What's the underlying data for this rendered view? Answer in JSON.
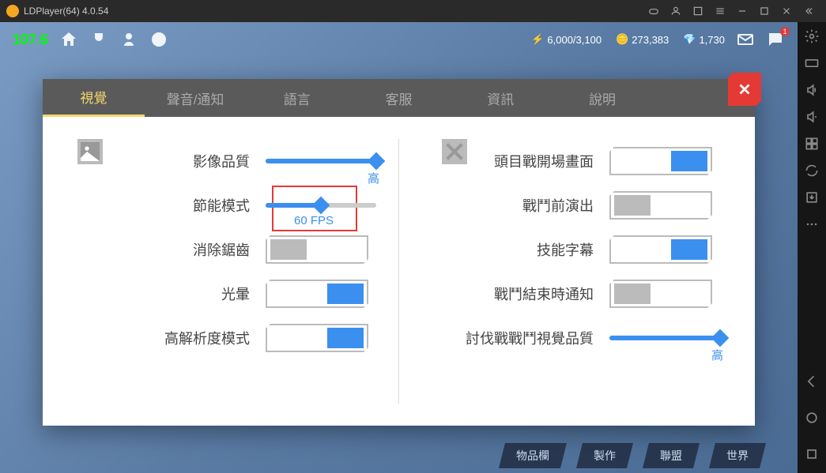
{
  "titlebar": {
    "title": "LDPlayer(64) 4.0.54"
  },
  "game": {
    "fps": "107.6",
    "currency1": "6,000/3,100",
    "currency2": "273,383",
    "currency3": "1,730",
    "notif_count": "1"
  },
  "settings": {
    "tabs": [
      "視覺",
      "聲音/通知",
      "語言",
      "客服",
      "資訊",
      "說明"
    ],
    "left": {
      "image_quality": {
        "label": "影像品質",
        "value_label": "高",
        "percent": 100
      },
      "power_saving": {
        "label": "節能模式",
        "value_label": "60 FPS",
        "percent": 50
      },
      "antialiasing": {
        "label": "消除鋸齒",
        "on": false
      },
      "bloom": {
        "label": "光暈",
        "on": true
      },
      "high_res": {
        "label": "高解析度模式",
        "on": true
      }
    },
    "right": {
      "boss_intro": {
        "label": "頭目戰開場畫面",
        "on": true
      },
      "pre_battle": {
        "label": "戰鬥前演出",
        "on": false
      },
      "skill_subtitle": {
        "label": "技能字幕",
        "on": true
      },
      "battle_end_notif": {
        "label": "戰鬥結束時通知",
        "on": false
      },
      "raid_quality": {
        "label": "討伐戰戰鬥視覺品質",
        "value_label": "高",
        "percent": 100
      }
    }
  },
  "bottomnav": [
    "物品欄",
    "製作",
    "聯盟",
    "世界"
  ]
}
